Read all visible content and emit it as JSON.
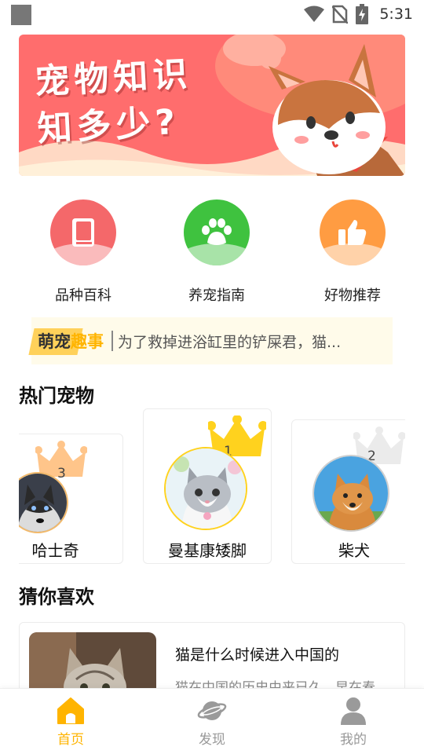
{
  "status_bar": {
    "time": "5:31"
  },
  "banner": {
    "line1": "宠物知识",
    "line2": "知多少?"
  },
  "categories": [
    {
      "label": "品种百科",
      "icon": "book-icon",
      "color": "#f4686a"
    },
    {
      "label": "养宠指南",
      "icon": "paw-icon",
      "color": "#3fc23f"
    },
    {
      "label": "好物推荐",
      "icon": "thumbs-up-icon",
      "color": "#ff9c42"
    }
  ],
  "news": {
    "tag_part1": "萌宠",
    "tag_part2": "趣事",
    "text": "为了救掉进浴缸里的铲屎君，猫..."
  },
  "hot_section": {
    "title": "热门宠物"
  },
  "hot_pets": [
    {
      "name": "哈士奇",
      "rank": "3"
    },
    {
      "name": "曼基康矮脚",
      "rank": "1"
    },
    {
      "name": "柴犬",
      "rank": "2"
    }
  ],
  "guess_section": {
    "title": "猜你喜欢"
  },
  "recommendation": {
    "title": "猫是什么时候进入中国的",
    "desc": "猫在中国的历史由来已久，早在春"
  },
  "bottom_nav": [
    {
      "label": "首页",
      "icon": "home-icon",
      "active": true
    },
    {
      "label": "发现",
      "icon": "planet-icon",
      "active": false
    },
    {
      "label": "我的",
      "icon": "user-icon",
      "active": false
    }
  ],
  "colors": {
    "accent": "#ffb400",
    "inactive": "#999999"
  }
}
